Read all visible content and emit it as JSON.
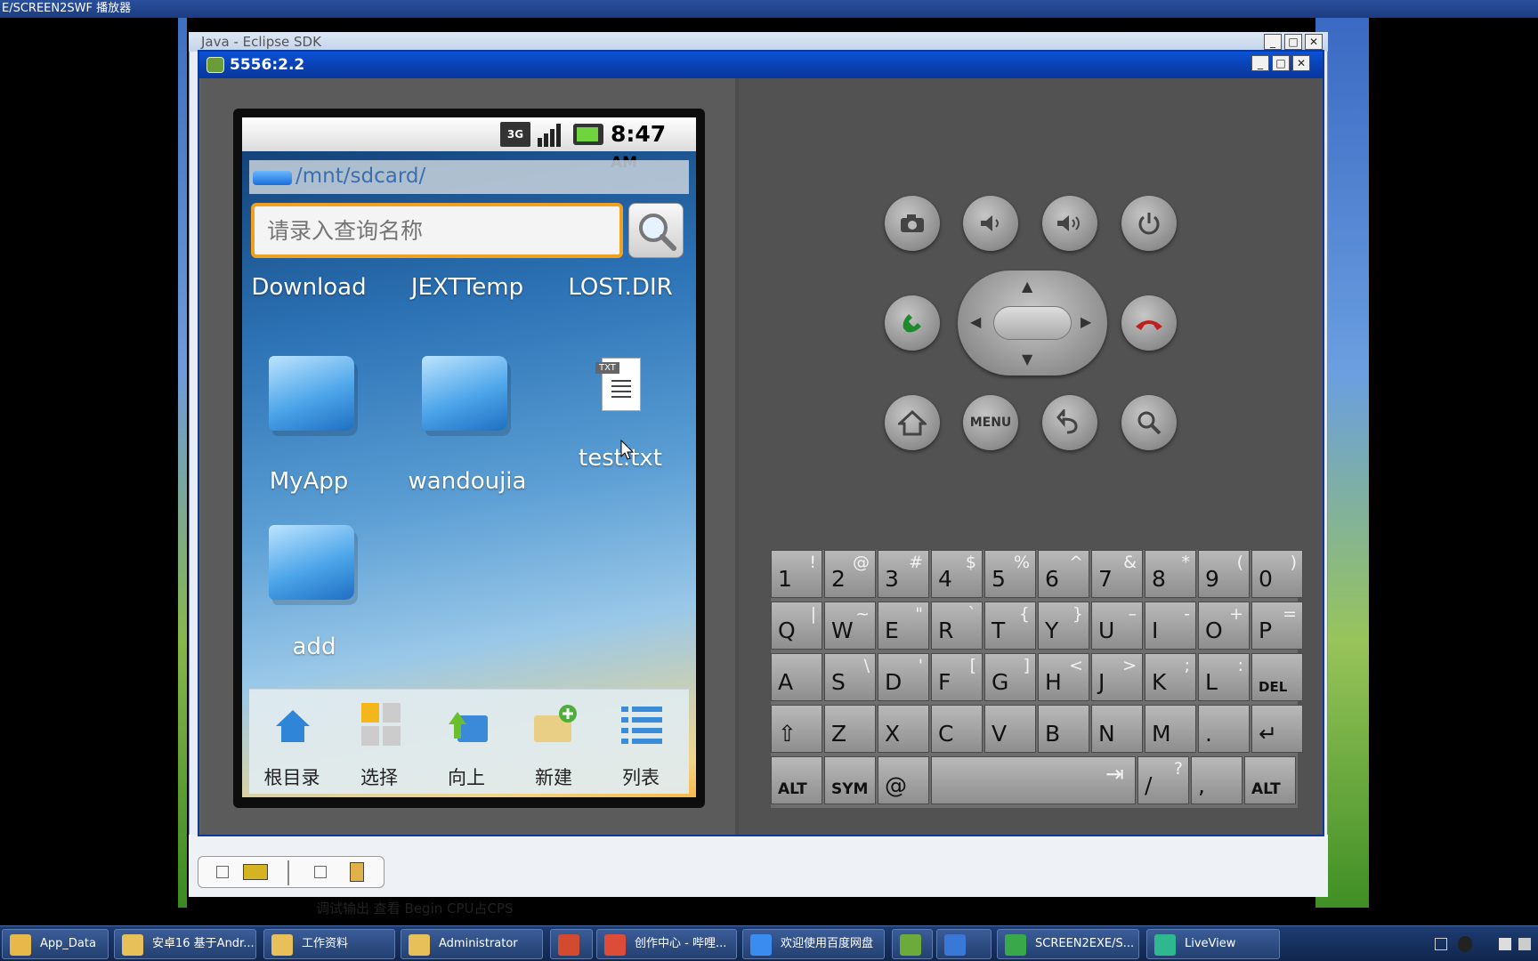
{
  "player": {
    "title": "E/SCREEN2SWF 播放器"
  },
  "eclipse": {
    "title": "Java - Eclipse SDK",
    "minimize": "_",
    "maximize": "□",
    "close": "✕",
    "bottom_status": "调试输出    查看 Begin    CPU占CPS"
  },
  "emulator": {
    "title": "5556:2.2",
    "minimize": "_",
    "maximize": "□",
    "close": "✕"
  },
  "phone": {
    "status": {
      "network_badge": "3G",
      "time": "8:47",
      "ampm": "AM"
    },
    "path": "/mnt/sdcard/",
    "search": {
      "placeholder": "请录入查询名称"
    },
    "files": [
      {
        "name": "Download",
        "type": "folder"
      },
      {
        "name": "JEXTTemp",
        "type": "folder"
      },
      {
        "name": "LOST.DIR",
        "type": "folder"
      },
      {
        "name": "MyApp",
        "type": "folder"
      },
      {
        "name": "wandoujia",
        "type": "folder"
      },
      {
        "name": "test.txt",
        "type": "txt"
      },
      {
        "name": "add",
        "type": "folder"
      }
    ],
    "txt_badge": "TXT",
    "toolbar": [
      {
        "label": "根目录",
        "icon": "home-icon"
      },
      {
        "label": "选择",
        "icon": "select-grid-icon"
      },
      {
        "label": "向上",
        "icon": "up-folder-icon"
      },
      {
        "label": "新建",
        "icon": "new-folder-icon"
      },
      {
        "label": "列表",
        "icon": "list-icon"
      }
    ]
  },
  "hardware": {
    "menu_label": "MENU"
  },
  "keyboard": {
    "row1": [
      {
        "main": "1",
        "alt": "!"
      },
      {
        "main": "2",
        "alt": "@"
      },
      {
        "main": "3",
        "alt": "#"
      },
      {
        "main": "4",
        "alt": "$"
      },
      {
        "main": "5",
        "alt": "%"
      },
      {
        "main": "6",
        "alt": "^"
      },
      {
        "main": "7",
        "alt": "&"
      },
      {
        "main": "8",
        "alt": "*"
      },
      {
        "main": "9",
        "alt": "("
      },
      {
        "main": "0",
        "alt": ")"
      }
    ],
    "row2": [
      {
        "main": "Q",
        "alt": "|"
      },
      {
        "main": "W",
        "alt": "~"
      },
      {
        "main": "E",
        "alt": "\""
      },
      {
        "main": "R",
        "alt": "`"
      },
      {
        "main": "T",
        "alt": "{"
      },
      {
        "main": "Y",
        "alt": "}"
      },
      {
        "main": "U",
        "alt": "–"
      },
      {
        "main": "I",
        "alt": "-"
      },
      {
        "main": "O",
        "alt": "+"
      },
      {
        "main": "P",
        "alt": "="
      }
    ],
    "row3": [
      {
        "main": "A",
        "alt": ""
      },
      {
        "main": "S",
        "alt": "\\"
      },
      {
        "main": "D",
        "alt": "'"
      },
      {
        "main": "F",
        "alt": "["
      },
      {
        "main": "G",
        "alt": "]"
      },
      {
        "main": "H",
        "alt": "<"
      },
      {
        "main": "J",
        "alt": ">"
      },
      {
        "main": "K",
        "alt": ";"
      },
      {
        "main": "L",
        "alt": ":"
      },
      {
        "main": "DEL",
        "alt": ""
      }
    ],
    "row4": [
      {
        "main": "⇧",
        "alt": ""
      },
      {
        "main": "Z",
        "alt": ""
      },
      {
        "main": "X",
        "alt": ""
      },
      {
        "main": "C",
        "alt": ""
      },
      {
        "main": "V",
        "alt": ""
      },
      {
        "main": "B",
        "alt": ""
      },
      {
        "main": "N",
        "alt": ""
      },
      {
        "main": "M",
        "alt": ""
      },
      {
        "main": ".",
        "alt": ""
      },
      {
        "main": "↵",
        "alt": ""
      }
    ],
    "row5": {
      "alt_left": "ALT",
      "sym": "SYM",
      "at": "@",
      "space_symbol": "⇥",
      "slash": "/",
      "slash_alt": "?",
      "comma": ",",
      "alt_right": "ALT"
    }
  },
  "taskbar": {
    "items": [
      {
        "label": "App_Data",
        "icon_color": "#e8b84a"
      },
      {
        "label": "安卓16 基于Andr...",
        "icon_color": "#e8c05a"
      },
      {
        "label": "工作资料",
        "icon_color": "#e8c05a"
      },
      {
        "label": "Administrator",
        "icon_color": "#e8c05a"
      },
      {
        "label": "",
        "icon_color": "#d34b2e"
      },
      {
        "label": "创作中心 - 哔哩...",
        "icon_color": "#dd4b39"
      },
      {
        "label": "欢迎使用百度网盘",
        "icon_color": "#3b8cf0"
      },
      {
        "label": "",
        "icon_color": "#6cab3b"
      },
      {
        "label": "",
        "icon_color": "#3a78d8"
      },
      {
        "label": "SCREEN2EXE/S...",
        "icon_color": "#39a84a"
      },
      {
        "label": "LiveView",
        "icon_color": "#2fb88f"
      }
    ]
  },
  "colors": {
    "accent_orange": "#f1a120",
    "emulator_title_blue": "#0a52d6"
  }
}
